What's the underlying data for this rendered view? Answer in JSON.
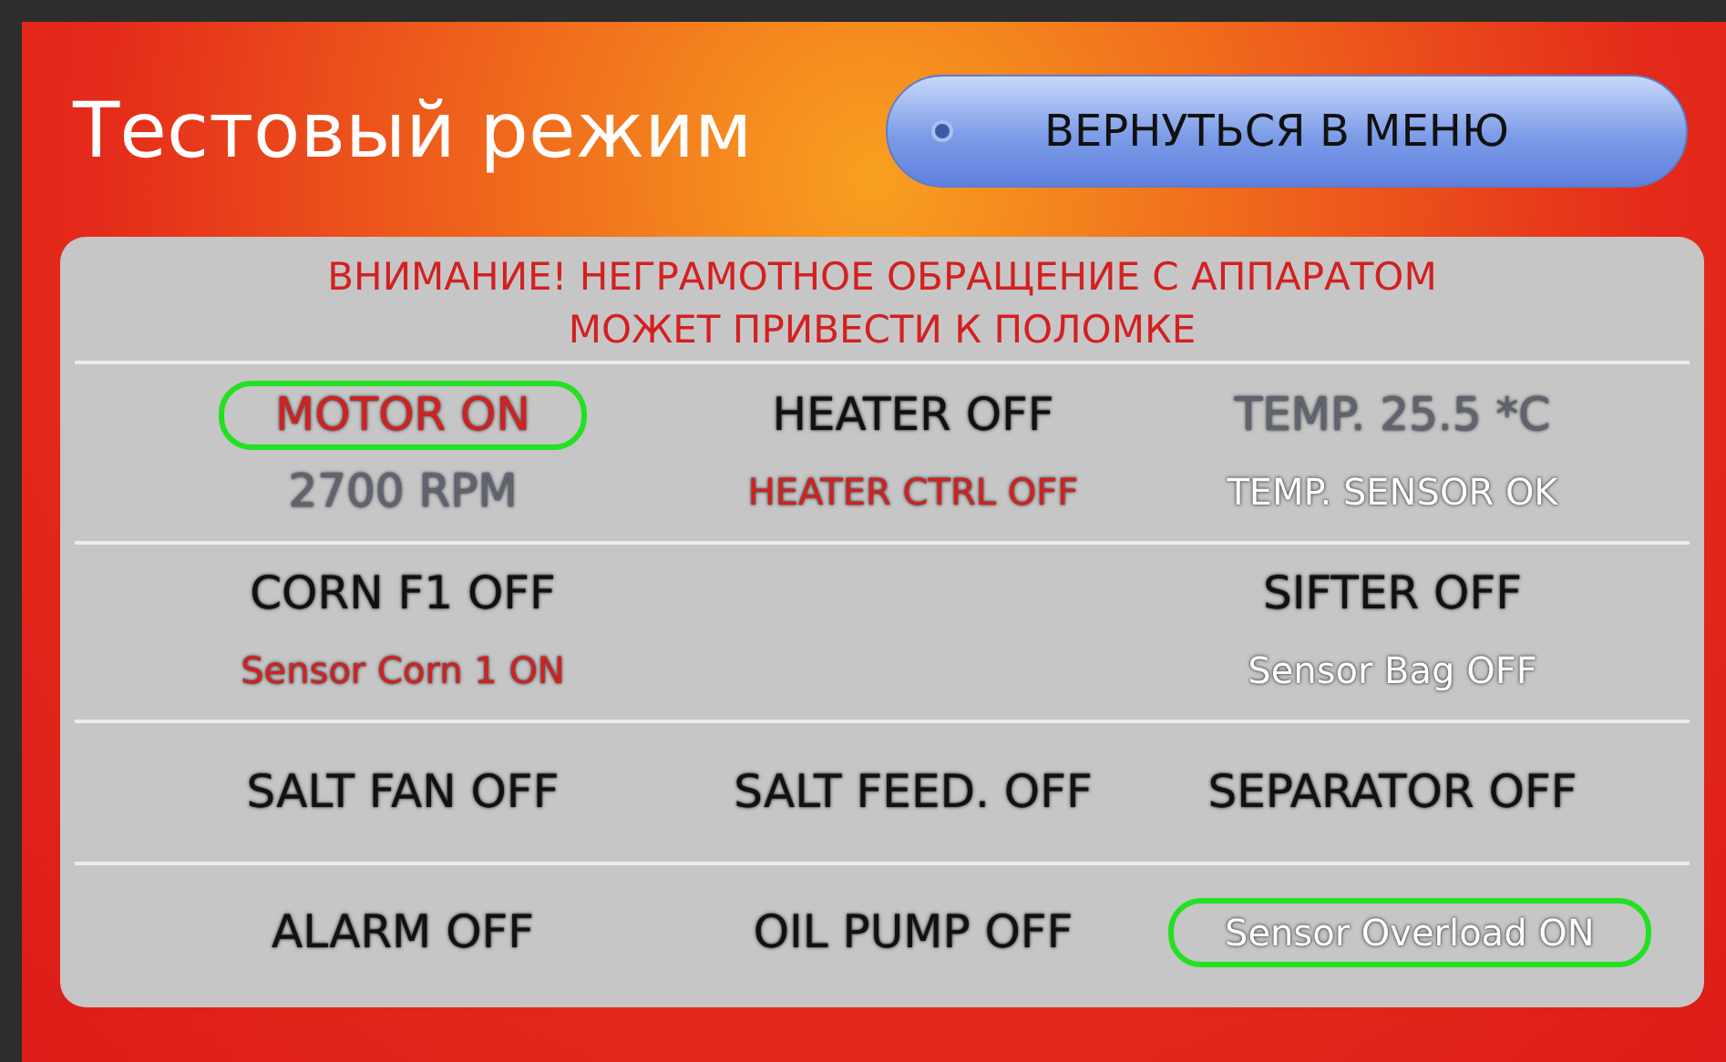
{
  "title": "Тестовый режим",
  "menu_button": {
    "label": "ВЕРНУТЬСЯ В МЕНЮ"
  },
  "warning": [
    "ВНИМАНИЕ! НЕГРАМОТНОЕ ОБРАЩЕНИЕ С АППАРАТОМ",
    "МОЖЕТ ПРИВЕСТИ К ПОЛОМКЕ"
  ],
  "rows": [
    {
      "cells": [
        {
          "lines": [
            {
              "text": "MOTOR ON",
              "color": "#d42020",
              "kind": "main",
              "highlighted": true
            },
            {
              "text": "2700  RPM",
              "color": "#5f6470",
              "kind": "main",
              "highlighted": false
            }
          ]
        },
        {
          "lines": [
            {
              "text": "HEATER OFF",
              "color": "#111111",
              "kind": "main",
              "highlighted": false
            },
            {
              "text": "HEATER CTRL OFF",
              "color": "#d42020",
              "kind": "sub",
              "highlighted": false
            }
          ]
        },
        {
          "lines": [
            {
              "text": "TEMP.  25.5 *C",
              "color": "#5f6470",
              "kind": "main",
              "highlighted": false
            },
            {
              "text": "TEMP. SENSOR OK",
              "color": "#ffffff",
              "kind": "sub",
              "highlighted": false
            }
          ]
        }
      ]
    },
    {
      "cells": [
        {
          "lines": [
            {
              "text": "CORN F1 OFF",
              "color": "#111111",
              "kind": "main",
              "highlighted": false
            },
            {
              "text": "Sensor Corn 1 ON",
              "color": "#d42020",
              "kind": "sub",
              "highlighted": false
            }
          ]
        },
        {},
        {
          "lines": [
            {
              "text": "SIFTER OFF",
              "color": "#111111",
              "kind": "main",
              "highlighted": false
            },
            {
              "text": "Sensor Bag OFF",
              "color": "#ffffff",
              "kind": "sub",
              "highlighted": false
            }
          ]
        }
      ]
    },
    {
      "cells": [
        {
          "lines": [
            {
              "text": "SALT FAN OFF",
              "color": "#111111",
              "kind": "main",
              "highlighted": false
            }
          ]
        },
        {
          "lines": [
            {
              "text": "SALT FEED. OFF",
              "color": "#111111",
              "kind": "main",
              "highlighted": false
            }
          ]
        },
        {
          "lines": [
            {
              "text": "SEPARATOR OFF",
              "color": "#111111",
              "kind": "main",
              "highlighted": false
            }
          ]
        }
      ]
    },
    {
      "cells": [
        {
          "lines": [
            {
              "text": "ALARM OFF",
              "color": "#111111",
              "kind": "main",
              "highlighted": false
            }
          ]
        },
        {
          "lines": [
            {
              "text": "OIL PUMP OFF",
              "color": "#111111",
              "kind": "main",
              "highlighted": false
            }
          ]
        },
        {
          "lines": [
            {
              "text": "Sensor Overload ON",
              "color": "#ffffff",
              "kind": "sub",
              "highlighted": true
            }
          ]
        }
      ]
    }
  ]
}
